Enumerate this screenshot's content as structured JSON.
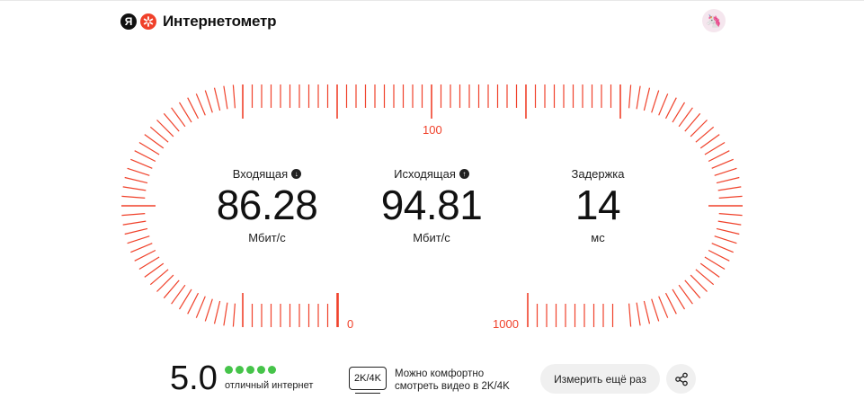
{
  "header": {
    "logo_letter": "Я",
    "brand": "Интернетометр"
  },
  "avatar": {
    "icon": "unicorn-avatar-icon"
  },
  "gauge": {
    "accent": "#f0412a",
    "scale_labels": [
      "100",
      "0",
      "1000"
    ]
  },
  "metrics": {
    "download": {
      "label": "Входящая",
      "value": "86.28",
      "unit": "Мбит/с",
      "icon": "download-arrow-icon"
    },
    "upload": {
      "label": "Исходящая",
      "value": "94.81",
      "unit": "Мбит/с",
      "icon": "upload-arrow-icon"
    },
    "latency": {
      "label": "Задержка",
      "value": "14",
      "unit": "мс"
    }
  },
  "footer": {
    "score": "5.0",
    "stars": 5,
    "star_color": "#46c44a",
    "rating_text": "отличный интернет",
    "badge": "2K/4K",
    "video_line1": "Можно комфортно",
    "video_line2": "смотреть видео в 2K/4K",
    "remeasure_label": "Измерить ещё раз",
    "share_icon": "share-icon"
  }
}
